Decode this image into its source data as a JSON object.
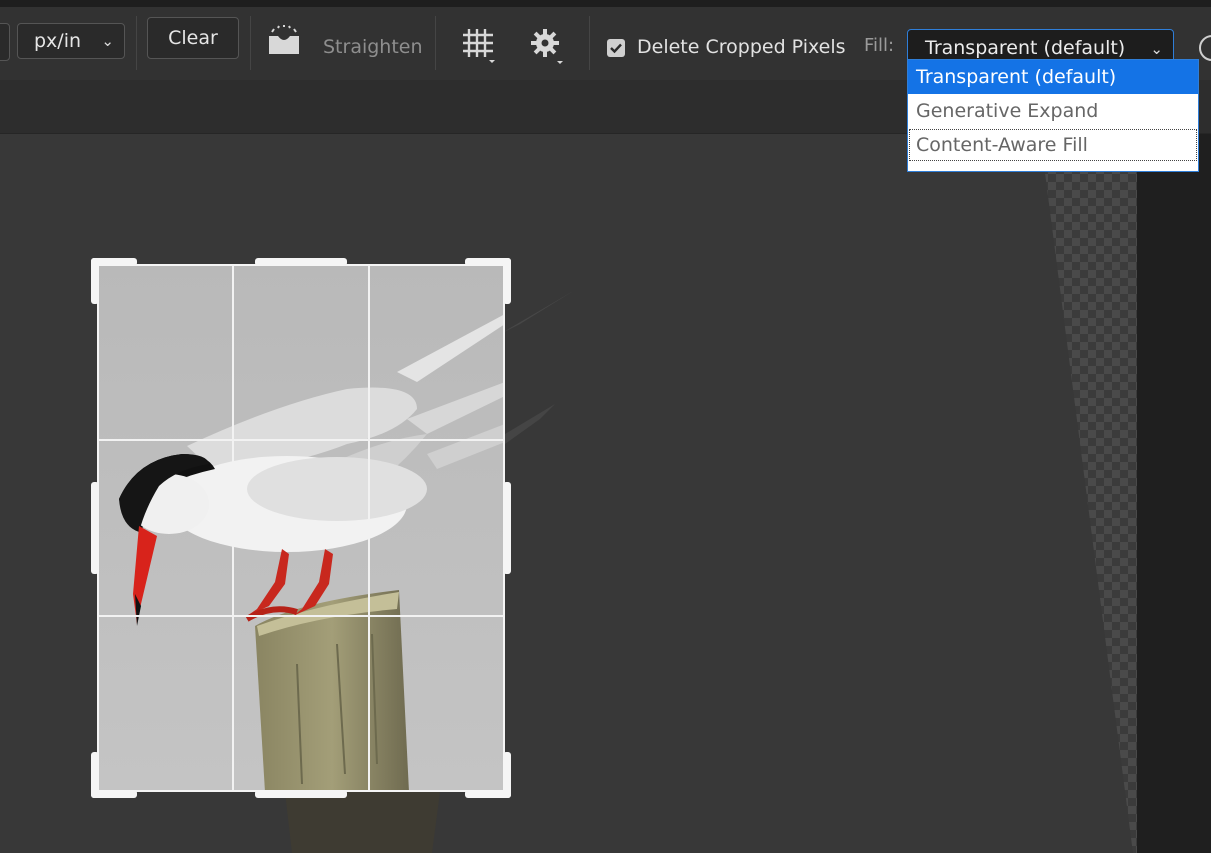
{
  "options_bar": {
    "units_select": {
      "value": "px/in"
    },
    "clear_label": "Clear",
    "straighten_label": "Straighten",
    "delete_cropped_pixels": {
      "label": "Delete Cropped Pixels",
      "checked": true
    },
    "fill": {
      "label": "Fill:",
      "value": "Transparent (default)",
      "options": [
        {
          "label": "Transparent (default)",
          "selected": true
        },
        {
          "label": "Generative Expand",
          "selected": false
        },
        {
          "label": "Content-Aware Fill",
          "selected": false
        }
      ]
    }
  },
  "colors": {
    "accent": "#1473e6",
    "toolbar_bg": "#323232",
    "canvas_bg": "#383838"
  },
  "icons": {
    "straighten": "straighten-icon",
    "overlay": "grid-overlay-icon",
    "settings": "gear-icon",
    "help": "help-icon"
  }
}
